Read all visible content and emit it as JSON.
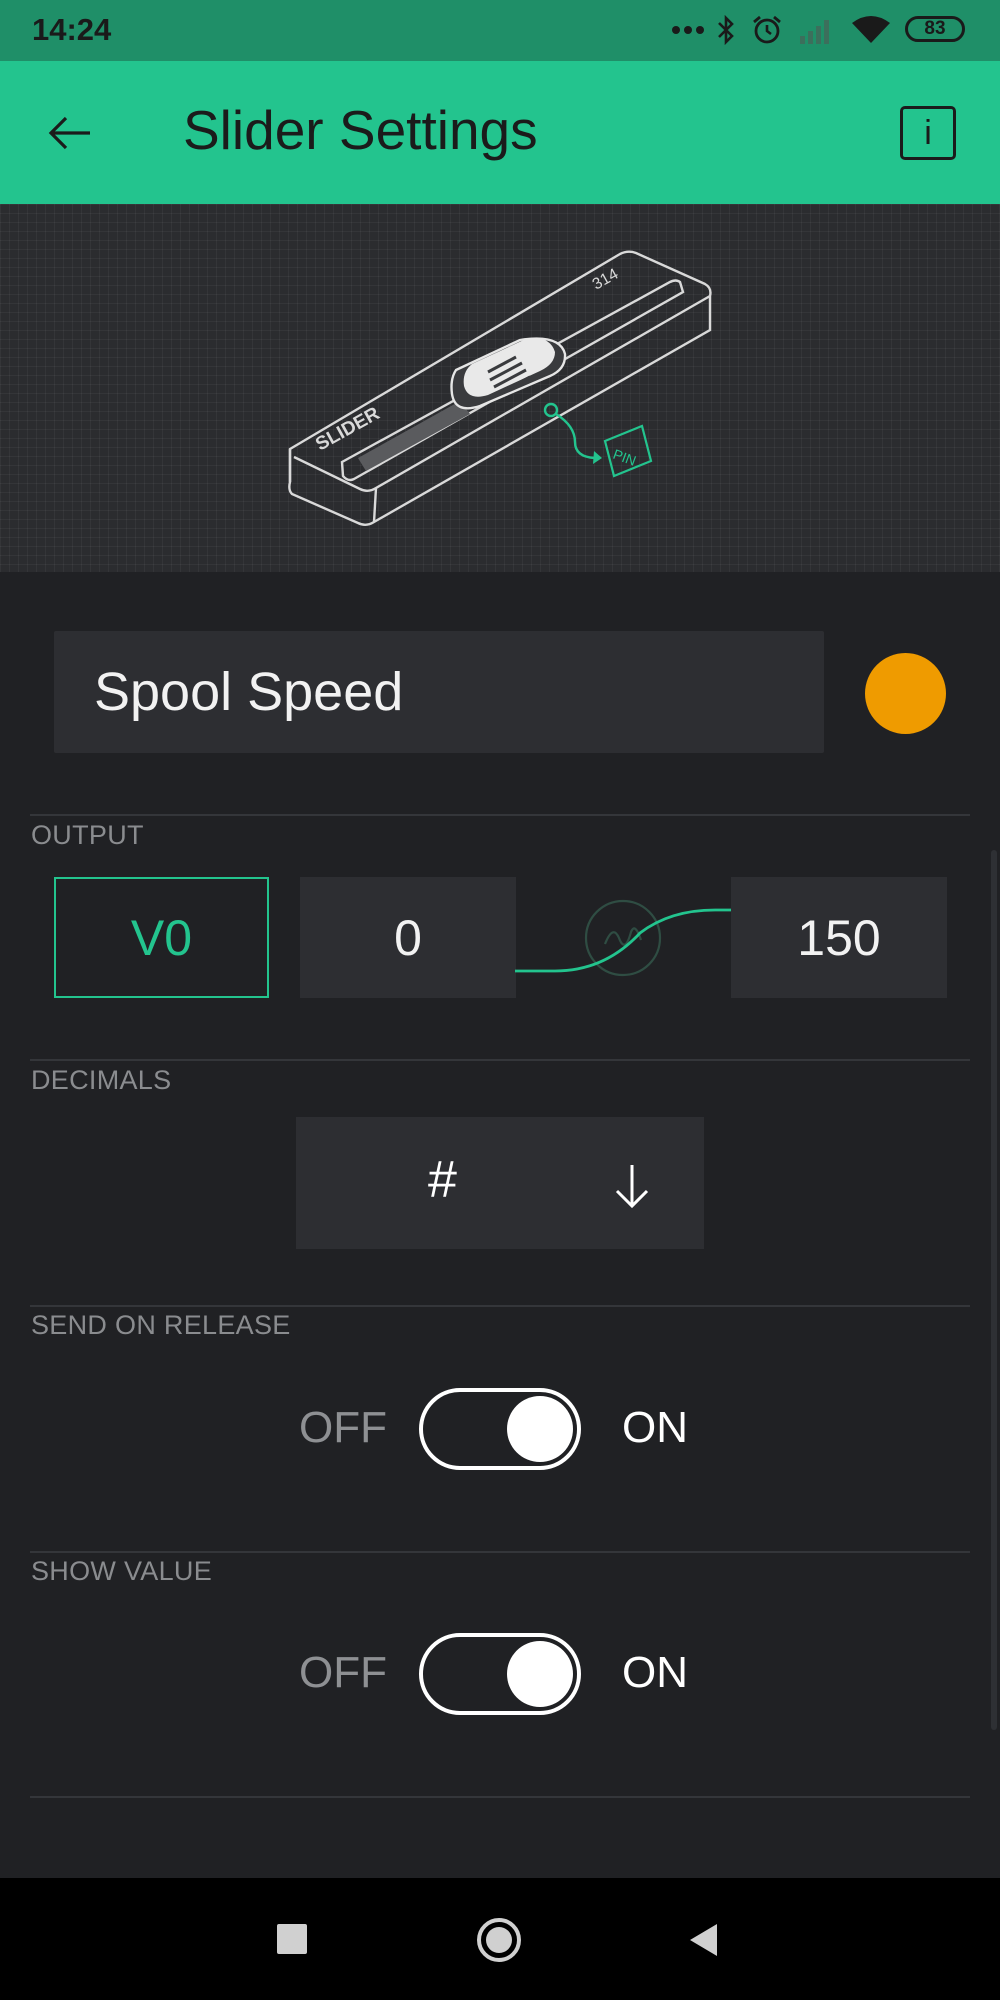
{
  "status_bar": {
    "time": "14:24",
    "battery": "83",
    "icons": [
      "more-dots-icon",
      "bluetooth-icon",
      "alarm-icon",
      "signal-icon",
      "wifi-icon",
      "battery-icon"
    ]
  },
  "app_bar": {
    "title": "Slider Settings",
    "info_label": "i"
  },
  "hero": {
    "device_label": "SLIDER",
    "device_value": "314",
    "pin_label": "PIN"
  },
  "widget": {
    "name": "Spool Speed",
    "color": "#ef9b00"
  },
  "output": {
    "label": "OUTPUT",
    "pin": "V0",
    "min": "0",
    "max": "150"
  },
  "decimals": {
    "label": "DECIMALS",
    "value": "#"
  },
  "send_on_release": {
    "label": "SEND ON RELEASE",
    "off": "OFF",
    "on": "ON",
    "state": "on"
  },
  "show_value": {
    "label": "SHOW VALUE",
    "off": "OFF",
    "on": "ON",
    "state": "on"
  },
  "colors": {
    "accent": "#23c48e",
    "background": "#202124",
    "field": "#2d2e32"
  }
}
